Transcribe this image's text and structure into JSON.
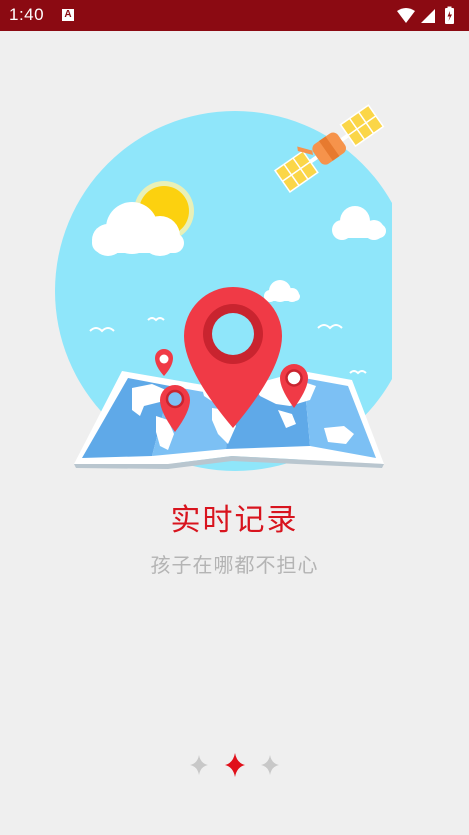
{
  "status_bar": {
    "time": "1:40",
    "notification_badge": "A",
    "icons": [
      "wifi-icon",
      "signal-icon",
      "battery-icon"
    ]
  },
  "onboarding": {
    "title": "实时记录",
    "subtitle": "孩子在哪都不担心",
    "pages_total": 3,
    "current_page": 2
  },
  "colors": {
    "status_bar": "#8b0a12",
    "title": "#d8141e",
    "subtitle": "#b4b4b4",
    "background": "#efefef",
    "sky": "#8fe6fa",
    "pin": "#f03a46",
    "map": "#6db4ee",
    "indicator_active": "#e0101a",
    "indicator_inactive": "#c8c8c8"
  }
}
